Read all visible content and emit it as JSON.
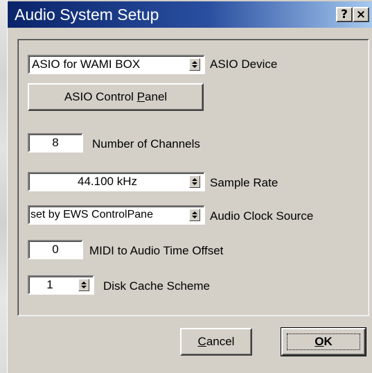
{
  "window": {
    "title": "Audio System Setup",
    "help_button": "?",
    "close_button": "×"
  },
  "asio_device": {
    "value": "ASIO for WAMI BOX",
    "label": "ASIO Device"
  },
  "control_panel_button": {
    "before": "ASIO Control ",
    "mnemonic": "P",
    "after": "anel"
  },
  "channels": {
    "value": "8",
    "label": "Number of Channels"
  },
  "sample_rate": {
    "value": "44.100 kHz",
    "label": "Sample Rate"
  },
  "clock_source": {
    "value": "set by EWS ControlPane",
    "label": "Audio Clock Source"
  },
  "midi_offset": {
    "value": "0",
    "label": "MIDI to Audio Time Offset"
  },
  "disk_cache": {
    "value": "1",
    "label": "Disk Cache Scheme"
  },
  "buttons": {
    "cancel": {
      "mnemonic": "C",
      "rest": "ancel"
    },
    "ok": {
      "mnemonic": "O",
      "rest": "K"
    }
  },
  "icons": {
    "dropdown": "dropdown-arrow-icon",
    "help": "help-icon",
    "close": "close-icon"
  },
  "colors": {
    "titlebar_start": "#0a246a",
    "titlebar_end": "#a6caf0",
    "face": "#d4d0c8"
  }
}
